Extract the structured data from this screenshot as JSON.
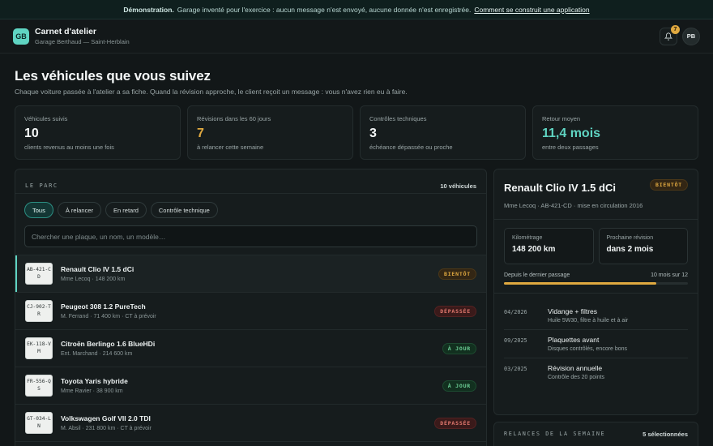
{
  "banner": {
    "bold": "Démonstration.",
    "text": "Garage inventé pour l'exercice : aucun message n'est envoyé, aucune donnée n'est enregistrée.",
    "link": "Comment se construit une application"
  },
  "topbar": {
    "logo": "GB",
    "title": "Carnet d'atelier",
    "subtitle": "Garage Berthaud — Saint-Herblain",
    "notif_count": "7",
    "user_initials": "PB"
  },
  "heading": {
    "title": "Les véhicules que vous suivez",
    "subtitle": "Chaque voiture passée à l'atelier a sa fiche. Quand la révision approche, le client reçoit un message : vous n'avez rien eu à faire."
  },
  "stats": [
    {
      "label": "Véhicules suivis",
      "value": "10",
      "sub": "clients revenus au moins une fois",
      "color": "#f4f7f7"
    },
    {
      "label": "Révisions dans les 60 jours",
      "value": "7",
      "sub": "à relancer cette semaine",
      "color": "#e0a940"
    },
    {
      "label": "Contrôles techniques",
      "value": "3",
      "sub": "échéance dépassée ou proche",
      "color": "#f4f7f7"
    },
    {
      "label": "Retour moyen",
      "value": "11,4 mois",
      "sub": "entre deux passages",
      "color": "#5fd4c2"
    }
  ],
  "parc": {
    "title": "LE PARC",
    "count": "10 véhicules",
    "filters": [
      "Tous",
      "À relancer",
      "En retard",
      "Contrôle technique"
    ],
    "search_placeholder": "Chercher une plaque, un nom, un modèle…",
    "vehicles": [
      {
        "plate": "AB-421-CD",
        "name": "Renault Clio IV 1.5 dCi",
        "meta": "Mme Lecoq · 148 200 km",
        "status": "BIENTÔT",
        "status_kind": "bientot"
      },
      {
        "plate": "CJ-902-TR",
        "name": "Peugeot 308 1.2 PureTech",
        "meta": "M. Ferrand · 71 400 km · CT à prévoir",
        "status": "DÉPASSÉE",
        "status_kind": "depassee"
      },
      {
        "plate": "EK-118-VM",
        "name": "Citroën Berlingo 1.6 BlueHDi",
        "meta": "Ent. Marchand · 214 600 km",
        "status": "À JOUR",
        "status_kind": "ajour"
      },
      {
        "plate": "FR-556-QS",
        "name": "Toyota Yaris hybride",
        "meta": "Mme Ravier · 38 900 km",
        "status": "À JOUR",
        "status_kind": "ajour"
      },
      {
        "plate": "GT-034-LN",
        "name": "Volkswagen Golf VII 2.0 TDI",
        "meta": "M. Absil · 231 800 km · CT à prévoir",
        "status": "DÉPASSÉE",
        "status_kind": "depassee"
      }
    ]
  },
  "detail": {
    "title": "Renault Clio IV 1.5 dCi",
    "badge": "BIENTÔT",
    "sub": "Mme Lecoq · AB-421-CD · mise en circulation 2016",
    "km_label": "Kilométrage",
    "km_value": "148 200 km",
    "next_label": "Prochaine révision",
    "next_value": "dans 2 mois",
    "progress_label": "Depuis le dernier passage",
    "progress_value": "10 mois sur 12",
    "progress_fraction": 0.83,
    "history": [
      {
        "date": "04/2026",
        "title": "Vidange + filtres",
        "desc": "Huile 5W30, filtre à huile et à air"
      },
      {
        "date": "09/2025",
        "title": "Plaquettes avant",
        "desc": "Disques contrôlés, encore bons"
      },
      {
        "date": "03/2025",
        "title": "Révision annuelle",
        "desc": "Contrôle des 20 points"
      }
    ]
  },
  "relances": {
    "title": "RELANCES DE LA SEMAINE",
    "count": "5 sélectionnées"
  },
  "colors": {
    "accent": "#5fd4c2",
    "warning": "#e0a940",
    "danger": "#e57a70",
    "ok": "#6fd49a"
  }
}
